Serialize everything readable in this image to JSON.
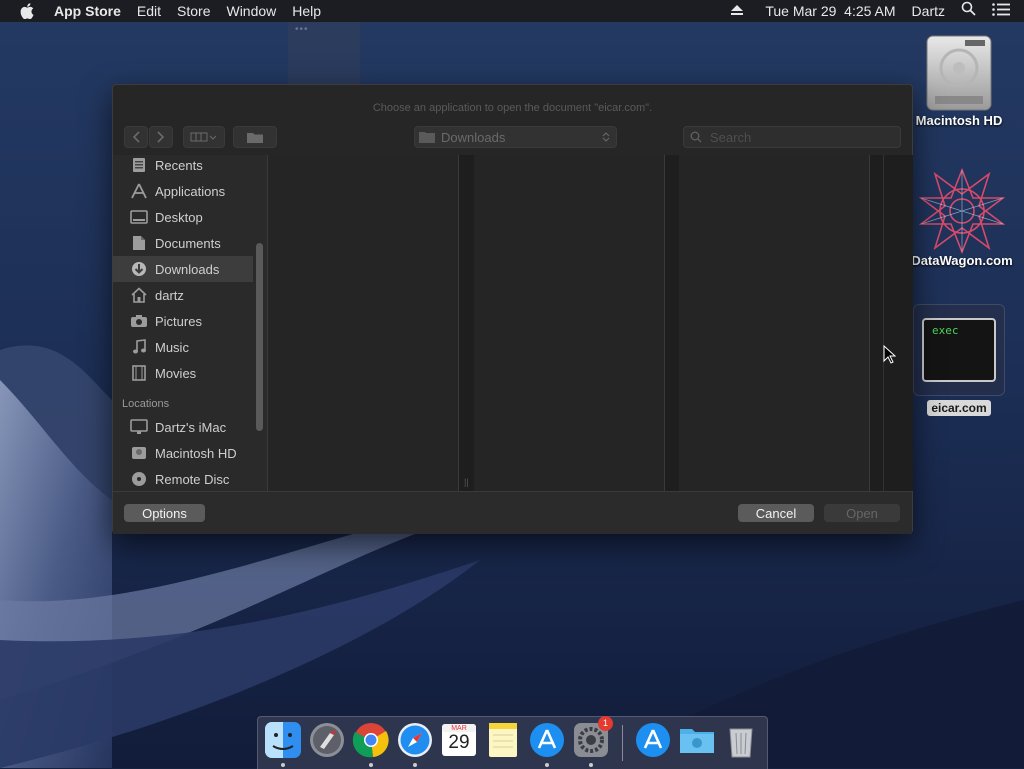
{
  "menubar": {
    "app_name": "App Store",
    "menus": [
      "Edit",
      "Store",
      "Window",
      "Help"
    ],
    "clock": "Tue Mar 29  4:25 AM",
    "user": "Dartz"
  },
  "desktop_icons": [
    {
      "label": "Macintosh HD",
      "icon": "hard-drive-icon"
    },
    {
      "label": "DataWagon.com",
      "icon": "datawagon-logo-icon"
    },
    {
      "label": "eicar.com",
      "icon": "terminal-exec-icon",
      "badge_text": "exec"
    }
  ],
  "dialog": {
    "title": "Choose an application to open the document \"eicar.com\".",
    "location": "Downloads",
    "search_placeholder": "Search",
    "sidebar": {
      "favorites": [
        {
          "label": "Recents",
          "icon": "recents-icon"
        },
        {
          "label": "Applications",
          "icon": "applications-icon"
        },
        {
          "label": "Desktop",
          "icon": "desktop-icon"
        },
        {
          "label": "Documents",
          "icon": "documents-icon"
        },
        {
          "label": "Downloads",
          "icon": "downloads-icon",
          "selected": true
        },
        {
          "label": "dartz",
          "icon": "home-icon"
        },
        {
          "label": "Pictures",
          "icon": "camera-icon"
        },
        {
          "label": "Music",
          "icon": "music-note-icon"
        },
        {
          "label": "Movies",
          "icon": "film-icon"
        }
      ],
      "locations_header": "Locations",
      "locations": [
        {
          "label": "Dartz's iMac",
          "icon": "imac-icon"
        },
        {
          "label": "Macintosh HD",
          "icon": "disk-icon"
        },
        {
          "label": "Remote Disc",
          "icon": "remote-disc-icon"
        }
      ]
    },
    "buttons": {
      "options": "Options",
      "cancel": "Cancel",
      "open": "Open"
    }
  },
  "dock": {
    "apps": [
      "finder-icon",
      "launchpad-icon",
      "chrome-icon",
      "safari-icon",
      "calendar-icon",
      "notes-icon",
      "app-store-icon",
      "system-preferences-icon",
      "app-store-icon",
      "downloads-folder-icon",
      "trash-icon"
    ],
    "calendar_month": "MAR",
    "calendar_day": "29",
    "system_prefs_badge": "1"
  },
  "colors": {
    "accent": "#2b8cf2",
    "dialog_bg": "#262626",
    "menubar_bg": "#1b1d22"
  }
}
